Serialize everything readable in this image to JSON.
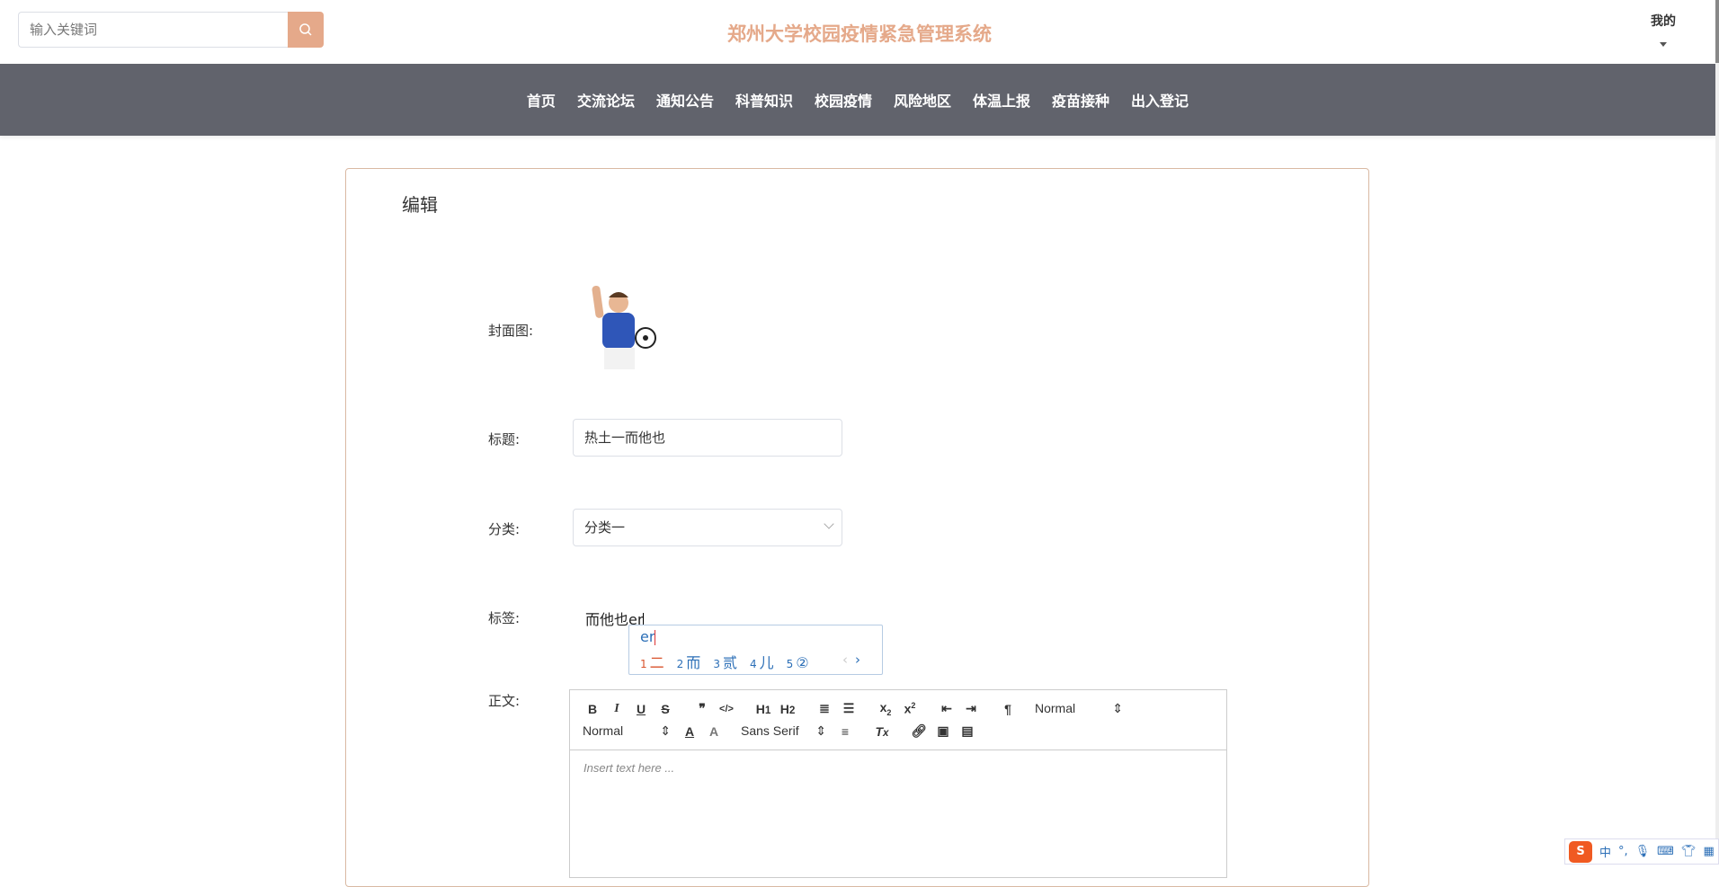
{
  "header": {
    "search_placeholder": "输入关键词",
    "site_title": "郑州大学校园疫情紧急管理系统",
    "user_menu": "我的"
  },
  "nav": [
    "首页",
    "交流论坛",
    "通知公告",
    "科普知识",
    "校园疫情",
    "风险地区",
    "体温上报",
    "疫苗接种",
    "出入登记"
  ],
  "form": {
    "card_title": "编辑",
    "cover_label": "封面图:",
    "title_label": "标题:",
    "title_value": "热土一而他也",
    "category_label": "分类:",
    "category_value": "分类一",
    "tag_label": "标签:",
    "tag_value": "而他也er",
    "content_label": "正文:",
    "editor_placeholder": "Insert text here ..."
  },
  "editor_toolbar": {
    "header_select": "Normal",
    "size_select": "Normal",
    "font_select": "Sans Serif"
  },
  "ime": {
    "composition": "er",
    "candidates": [
      {
        "n": "1",
        "t": "二"
      },
      {
        "n": "2",
        "t": "而"
      },
      {
        "n": "3",
        "t": "贰"
      },
      {
        "n": "4",
        "t": "儿"
      },
      {
        "n": "5",
        "t": "②"
      }
    ],
    "prev": "‹",
    "next": "›"
  },
  "tray": {
    "logo": "S",
    "mode": "中",
    "punct": "°,"
  },
  "colors": {
    "accent": "#e5a98a",
    "nav_bg": "#61636c",
    "ime_blue": "#2c6fb7"
  }
}
